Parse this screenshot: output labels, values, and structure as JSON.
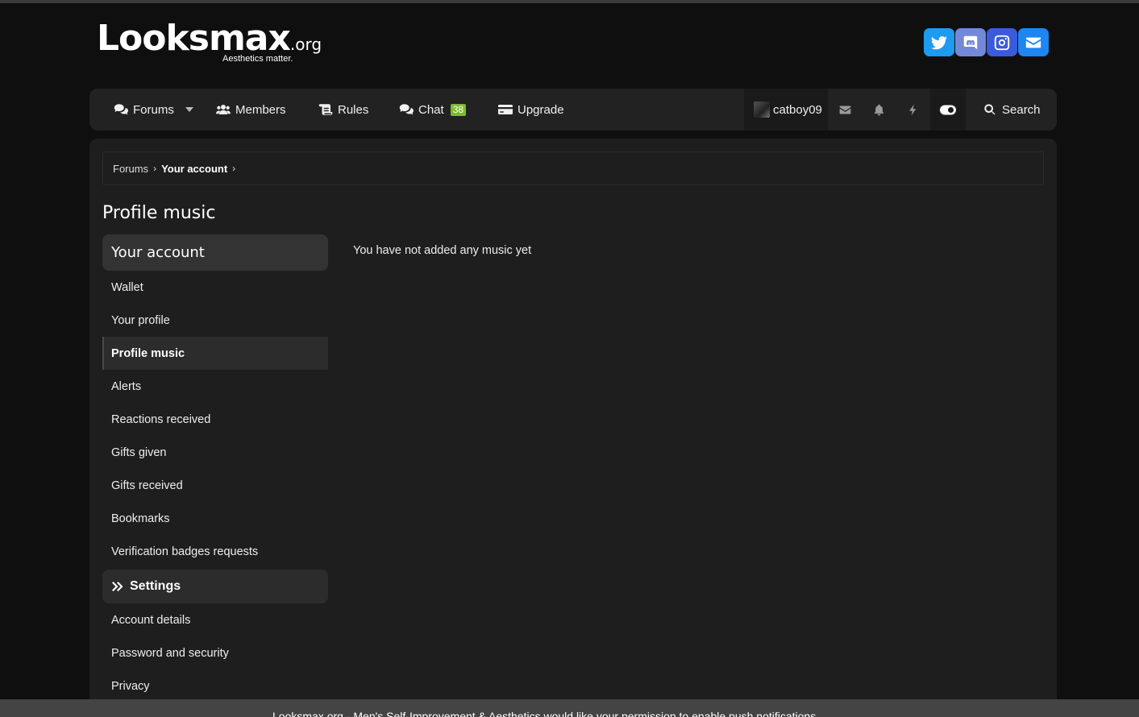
{
  "logo": {
    "main": "Looksmax",
    "suffix": ".org",
    "tagline": "Aesthetics matter."
  },
  "socials": [
    {
      "name": "twitter",
      "color": "#1d9bf0"
    },
    {
      "name": "discord",
      "color": "#5865f2"
    },
    {
      "name": "instagram",
      "color": "#3b5bdb"
    },
    {
      "name": "email",
      "color": "#1d86f0"
    }
  ],
  "nav": {
    "forums": "Forums",
    "members": "Members",
    "rules": "Rules",
    "chat": "Chat",
    "chat_badge": "38",
    "upgrade": "Upgrade",
    "username": "catboy09",
    "search": "Search"
  },
  "breadcrumb": {
    "root": "Forums",
    "current": "Your account"
  },
  "page": {
    "title": "Profile music",
    "empty_message": "You have not added any music yet"
  },
  "sidebar": {
    "section1": "Your account",
    "items1": [
      "Wallet",
      "Your profile",
      "Profile music",
      "Alerts",
      "Reactions received",
      "Gifts given",
      "Gifts received",
      "Bookmarks",
      "Verification badges requests"
    ],
    "section2": "Settings",
    "items2": [
      "Account details",
      "Password and security",
      "Privacy"
    ]
  },
  "footer": {
    "text": "Looksmax.org - Men's Self-Improvement & Aesthetics would like your permission to",
    "link": "enable push notifications."
  },
  "colors": {
    "accent_badge": "#7cbb2c",
    "background": "#0f0f0f",
    "panel": "#1e1e1e"
  }
}
